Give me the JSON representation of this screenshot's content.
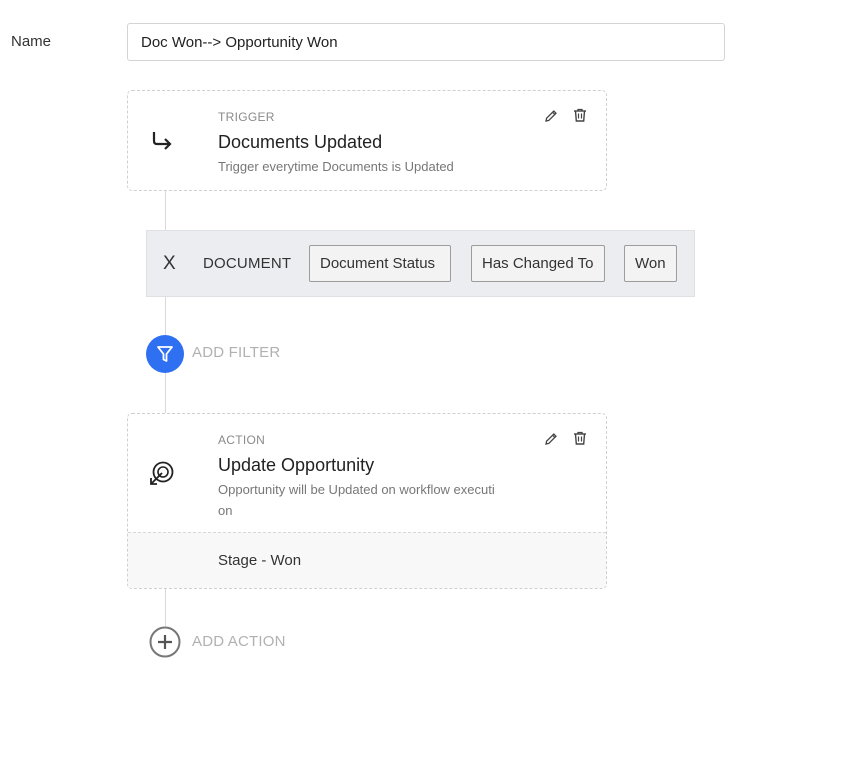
{
  "form": {
    "name_label": "Name",
    "name_value": "Doc Won--> Opportunity Won"
  },
  "trigger": {
    "type_label": "TRIGGER",
    "title": "Documents Updated",
    "description": "Trigger everytime Documents is Updated",
    "icon": "arrow-turn-down-right-icon"
  },
  "filter": {
    "remove_label": "X",
    "entity": "DOCUMENT",
    "field": "Document Status",
    "operator": "Has Changed To",
    "value": "Won"
  },
  "add_filter": {
    "label": "ADD FILTER",
    "icon": "funnel-icon",
    "color": "#2f6ff2"
  },
  "action": {
    "type_label": "ACTION",
    "title": "Update Opportunity",
    "description_line1": "Opportunity will be Updated on workflow executi",
    "description_line2": "on",
    "detail": "Stage - Won",
    "icon": "target-arrow-icon"
  },
  "add_action": {
    "label": "ADD ACTION",
    "icon": "plus-circle-icon"
  }
}
